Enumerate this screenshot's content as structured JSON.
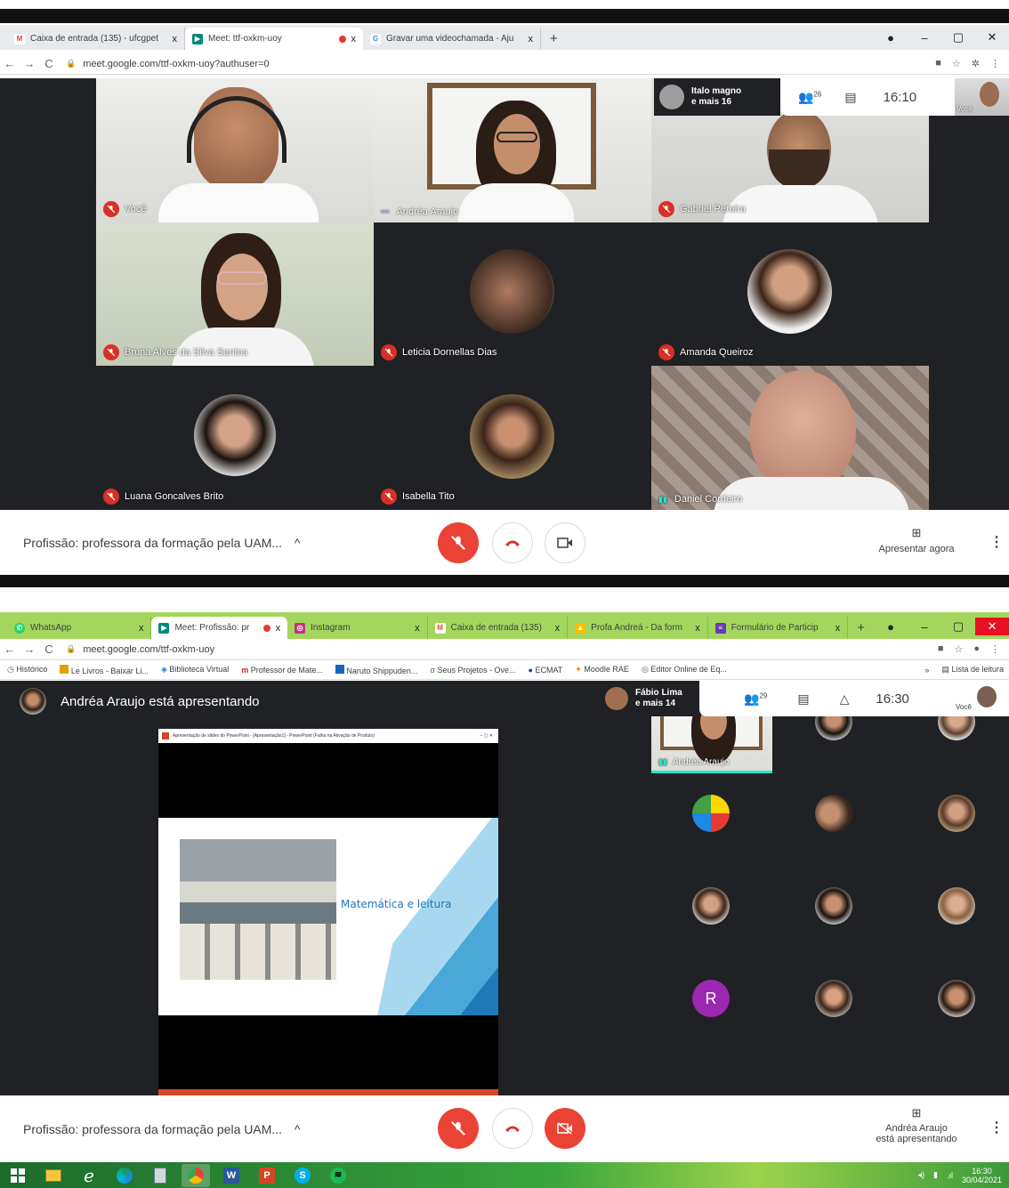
{
  "top": {
    "tabs": [
      {
        "icon": "gmail-icon",
        "label": "Caixa de entrada (135) - ufcgpet",
        "close": "x",
        "color": "#ea4335",
        "glyph": "M"
      },
      {
        "icon": "meet-icon",
        "label": "Meet: ttf-oxkm-uoy",
        "close": "x",
        "color": "#00897b",
        "glyph": "▶"
      },
      {
        "icon": "google-icon",
        "label": "Gravar uma videochamada - Aju",
        "close": "x",
        "color": "#4285f4",
        "glyph": "G"
      }
    ],
    "new_tab": "+",
    "window_controls": [
      "●",
      "–",
      "▢",
      "✕"
    ],
    "url": "meet.google.com/ttf-oxkm-uoy?authuser=0",
    "grid_tiles": [
      {
        "name": "Você",
        "muted": true
      },
      {
        "name": "Andréa Araujo",
        "muted": false,
        "indicator": "•••"
      },
      {
        "name": "Gabriel Pereira",
        "muted": true
      },
      {
        "name": "Bruna Alves da Silva Santos",
        "muted": true
      },
      {
        "name": "Leticia Dornellas Dias",
        "muted": true
      },
      {
        "name": "Amanda Queiroz",
        "muted": true
      },
      {
        "name": "Luana Goncalves Brito",
        "muted": true
      },
      {
        "name": "Isabella Tito",
        "muted": true
      },
      {
        "name": "Daniel Cordeiro",
        "muted": false,
        "indicator": "▮▮"
      }
    ],
    "speaker_chip": {
      "line1": "Italo magno",
      "line2": "e mais 16"
    },
    "participants_count": "26",
    "clock": "16:10",
    "self_label": "Você",
    "meeting_details": "Profissão: professora da formação pela UAM...",
    "present_label": "Apresentar agora"
  },
  "bottom": {
    "tabs": [
      {
        "icon": "whatsapp-icon",
        "label": "WhatsApp",
        "close": "x",
        "color": "#25d366",
        "glyph": "✆"
      },
      {
        "icon": "meet-icon",
        "label": "Meet: Profissão: pr",
        "close": "x",
        "color": "#00897b",
        "glyph": "▶"
      },
      {
        "icon": "instagram-icon",
        "label": "Instagram",
        "close": "x",
        "color": "#c13584",
        "glyph": "◎"
      },
      {
        "icon": "gmail-icon",
        "label": "Caixa de entrada (135)",
        "close": "x",
        "color": "#ea4335",
        "glyph": "M"
      },
      {
        "icon": "drive-icon",
        "label": "Profa Andreá - Da form",
        "close": "x",
        "color": "#fbbc04",
        "glyph": "▲"
      },
      {
        "icon": "forms-icon",
        "label": "Formulário de Particip",
        "close": "x",
        "color": "#673ab7",
        "glyph": "≡"
      }
    ],
    "new_tab": "+",
    "url": "meet.google.com/ttf-oxkm-uoy",
    "bookmarks": [
      {
        "label": "Histórico",
        "color": "#5f6368"
      },
      {
        "label": "Le Livros - Baixar Li...",
        "color": "#e8a000"
      },
      {
        "label": "Biblioteca Virtual",
        "color": "#1976d2"
      },
      {
        "label": "Professor de Mate...",
        "color": "#c62828"
      },
      {
        "label": "Naruto Shippuden...",
        "color": "#1565c0"
      },
      {
        "label": "Seus Projetos - Ove...",
        "color": "#2e7d32"
      },
      {
        "label": "ECMAT",
        "color": "#0d47a1"
      },
      {
        "label": "Moodle RAE",
        "color": "#f57c00"
      },
      {
        "label": "Editor Online de Eq...",
        "color": "#616161"
      }
    ],
    "more_bookmarks": "»",
    "reading_list": "Lista de leitura",
    "presenter_banner": "Andréa Araujo está apresentando",
    "speaker_chip": {
      "line1": "Fábio Lima",
      "line2": "e mais 14"
    },
    "participants_count": "29",
    "clock": "16:30",
    "self_label": "Você",
    "window_title": "Apresentação de slides do PowerPoint - [Apresentação1] - PowerPoint (Falha na Ativação de Produto)",
    "slide_title": "Matemática e leitura",
    "side_tile_name": "Andréa Araujo",
    "avatar_letter": "R",
    "meeting_details": "Profissão: professora da formação pela UAM...",
    "presenting_line1": "Andréa Araujo",
    "presenting_line2": "está apresentando"
  },
  "taskbar": {
    "time": "16:30",
    "date": "30/04/2021",
    "apps": [
      "windows-start-icon",
      "explorer-icon",
      "ie-icon",
      "edge-icon",
      "notepad-icon",
      "chrome-icon",
      "word-icon",
      "powerpoint-icon",
      "skype-icon",
      "spotify-icon"
    ]
  },
  "colors": {
    "meet_dark": "#202124",
    "tile_dark": "#3c4043",
    "mute_red": "#d93025",
    "accent_teal": "#1ee6c8"
  }
}
